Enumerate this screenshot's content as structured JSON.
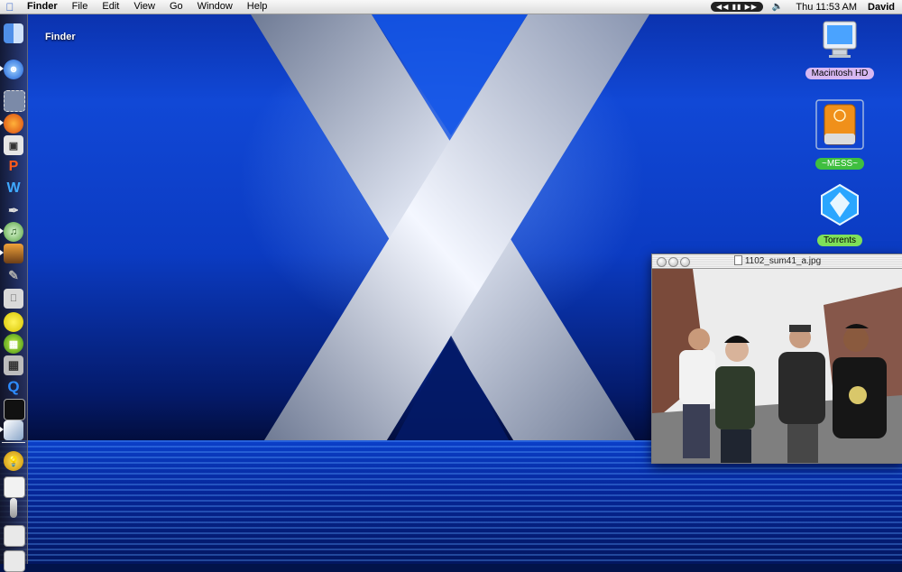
{
  "menubar": {
    "app_name": "Finder",
    "menus": [
      "File",
      "Edit",
      "View",
      "Go",
      "Window",
      "Help"
    ],
    "clock": "Thu 11:53 AM",
    "user": "David",
    "media_controls": "◀◀ ▮▮ ▶▶"
  },
  "desktop": {
    "finder_label": "Finder",
    "icons": [
      {
        "label": "Macintosh HD",
        "icon": "hard-drive-icon",
        "label_color": "#d7b8f2"
      },
      {
        "label": "~MESS~",
        "icon": "external-drive-icon",
        "label_color": "#3fbf3f"
      },
      {
        "label": "Torrents",
        "icon": "torrent-folder-icon",
        "label_color": "#7fe05a"
      }
    ]
  },
  "dock": {
    "items": [
      {
        "name": "finder-icon",
        "running": false
      },
      {
        "name": "ichat-icon",
        "running": true
      },
      {
        "name": "mail-stamp-icon",
        "running": false
      },
      {
        "name": "firefox-icon",
        "running": true
      },
      {
        "name": "ipod-icon",
        "running": false
      },
      {
        "name": "p-app-icon",
        "running": false
      },
      {
        "name": "w-app-icon",
        "running": false
      },
      {
        "name": "pen-app-icon",
        "running": false
      },
      {
        "name": "itunes-icon",
        "running": true
      },
      {
        "name": "iphoto-icon",
        "running": true
      },
      {
        "name": "pencil-app-icon",
        "running": false
      },
      {
        "name": "system-prefs-icon",
        "running": false
      },
      {
        "name": "lemon-icon",
        "running": false
      },
      {
        "name": "green-app-icon",
        "running": false
      },
      {
        "name": "calculator-icon",
        "running": false
      },
      {
        "name": "quicktime-icon",
        "running": false
      },
      {
        "name": "terminal-icon",
        "running": false
      },
      {
        "name": "preview-icon",
        "running": true
      },
      {
        "name": "bulb-icon",
        "running": false
      },
      {
        "name": "document-icon",
        "running": false
      },
      {
        "name": "thermometer-icon",
        "running": false
      },
      {
        "name": "minimized-window-icon",
        "running": false
      },
      {
        "name": "minimized-window-2-icon",
        "running": false
      }
    ]
  },
  "window": {
    "title": "1102_sum41_a.jpg"
  }
}
